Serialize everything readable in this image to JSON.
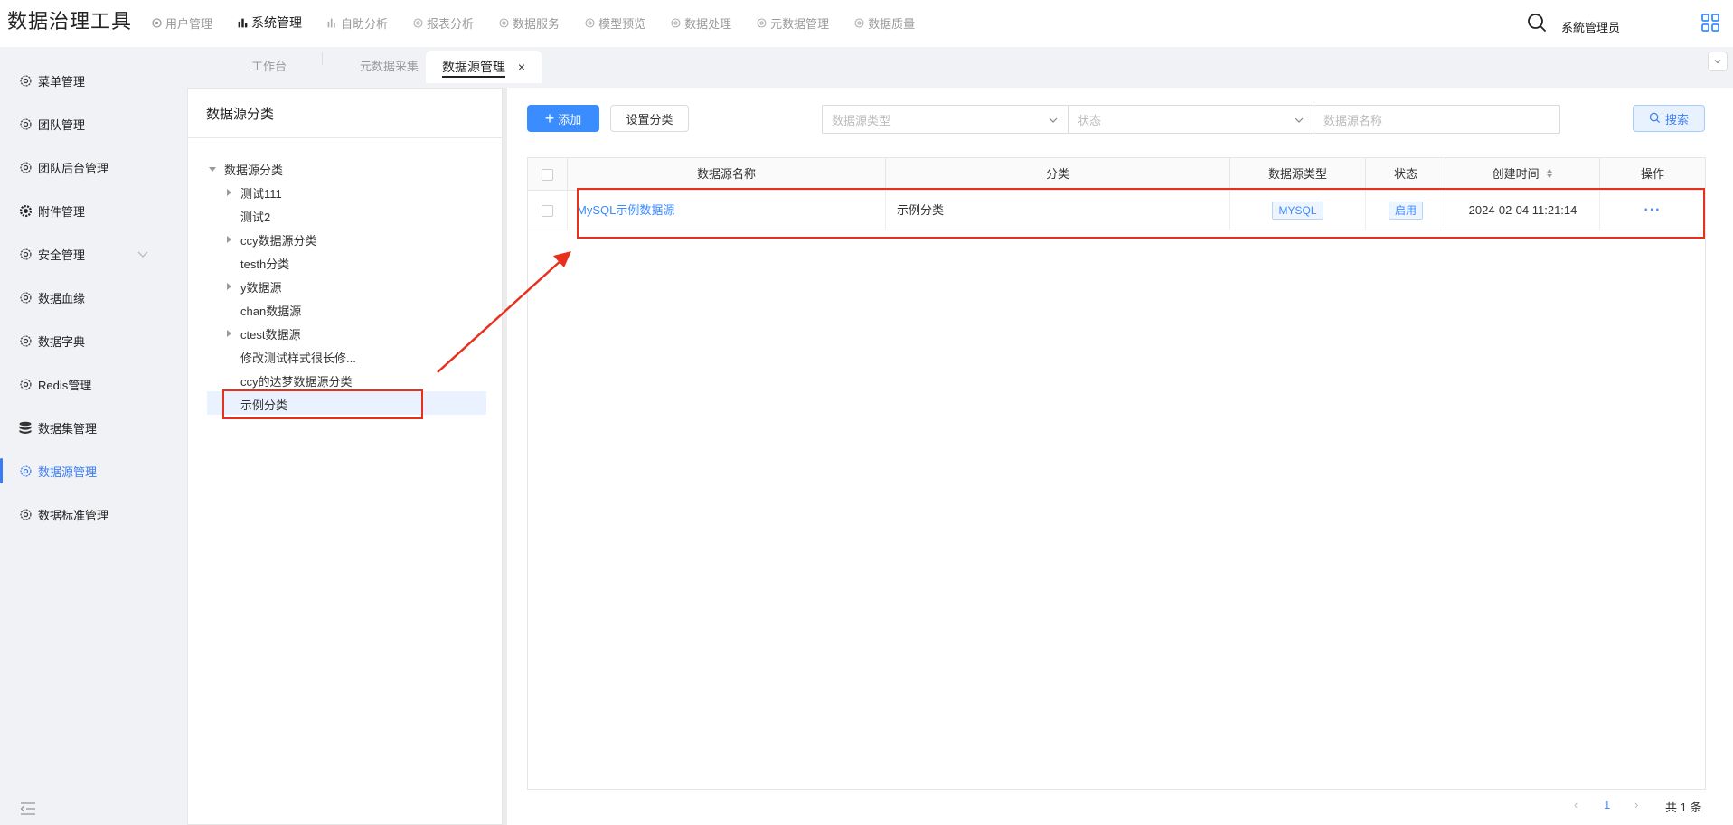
{
  "app": {
    "title": "数据治理工具"
  },
  "topnav": [
    {
      "label": "用户管理",
      "icon": "gear-icon"
    },
    {
      "label": "系统管理",
      "icon": "bar-chart-icon",
      "active": true
    },
    {
      "label": "自助分析",
      "icon": "bar-chart-icon"
    },
    {
      "label": "报表分析",
      "icon": "gear-icon"
    },
    {
      "label": "数据服务",
      "icon": "gear-icon"
    },
    {
      "label": "模型预览",
      "icon": "gear-icon"
    },
    {
      "label": "数据处理",
      "icon": "gear-icon"
    },
    {
      "label": "元数据管理",
      "icon": "gear-icon"
    },
    {
      "label": "数据质量",
      "icon": "gear-icon"
    }
  ],
  "user": {
    "name": "系統管理员"
  },
  "tabs": [
    {
      "label": "工作台"
    },
    {
      "label": "元数据采集"
    },
    {
      "label": "数据源管理",
      "active": true,
      "close": "×"
    }
  ],
  "sidebar": {
    "items": [
      {
        "label": "菜单管理",
        "icon": "gear-icon"
      },
      {
        "label": "团队管理",
        "icon": "gear-icon"
      },
      {
        "label": "团队后台管理",
        "icon": "gear-icon"
      },
      {
        "label": "附件管理",
        "icon": "gear-solid-icon"
      },
      {
        "label": "安全管理",
        "icon": "gear-icon",
        "expandable": true
      },
      {
        "label": "数据血缘",
        "icon": "gear-icon"
      },
      {
        "label": "数据字典",
        "icon": "gear-icon"
      },
      {
        "label": "Redis管理",
        "icon": "gear-icon"
      },
      {
        "label": "数据集管理",
        "icon": "database-icon"
      },
      {
        "label": "数据源管理",
        "icon": "gear-icon",
        "active": true
      },
      {
        "label": "数据标准管理",
        "icon": "gear-icon"
      }
    ]
  },
  "left_panel": {
    "title": "数据源分类",
    "tree": [
      {
        "label": "数据源分类",
        "level": 0,
        "expanded": true
      },
      {
        "label": "测试111",
        "level": 1,
        "has_children": true
      },
      {
        "label": "测试2",
        "level": 1
      },
      {
        "label": "ccy数据源分类",
        "level": 1,
        "has_children": true
      },
      {
        "label": "testh分类",
        "level": 1
      },
      {
        "label": "y数据源",
        "level": 1,
        "has_children": true
      },
      {
        "label": "chan数据源",
        "level": 1
      },
      {
        "label": "ctest数据源",
        "level": 1,
        "has_children": true
      },
      {
        "label": "修改测试样式很长修...",
        "level": 1
      },
      {
        "label": "ccy的达梦数据源分类",
        "level": 1
      },
      {
        "label": "示例分类",
        "level": 1,
        "selected": true
      }
    ]
  },
  "toolbar": {
    "add_label": "添加",
    "add_icon": "plus-icon",
    "set_category_label": "设置分类",
    "type_placeholder": "数据源类型",
    "status_placeholder": "状态",
    "name_placeholder": "数据源名称",
    "search_label": "搜索"
  },
  "table": {
    "columns": [
      "数据源名称",
      "分类",
      "数据源类型",
      "状态",
      "创建时间",
      "操作"
    ],
    "rows": [
      {
        "name": "MySQL示例数据源",
        "category": "示例分类",
        "type": "MYSQL",
        "status": "启用",
        "created": "2024-02-04 11:21:14",
        "action": "···"
      }
    ]
  },
  "pagination": {
    "prev": "‹",
    "current": "1",
    "next": "›",
    "total": "共 1 条"
  },
  "colors": {
    "accent": "#3b8cff",
    "annotation_red": "#e8301d",
    "selected_bg": "#eaf2ff"
  }
}
